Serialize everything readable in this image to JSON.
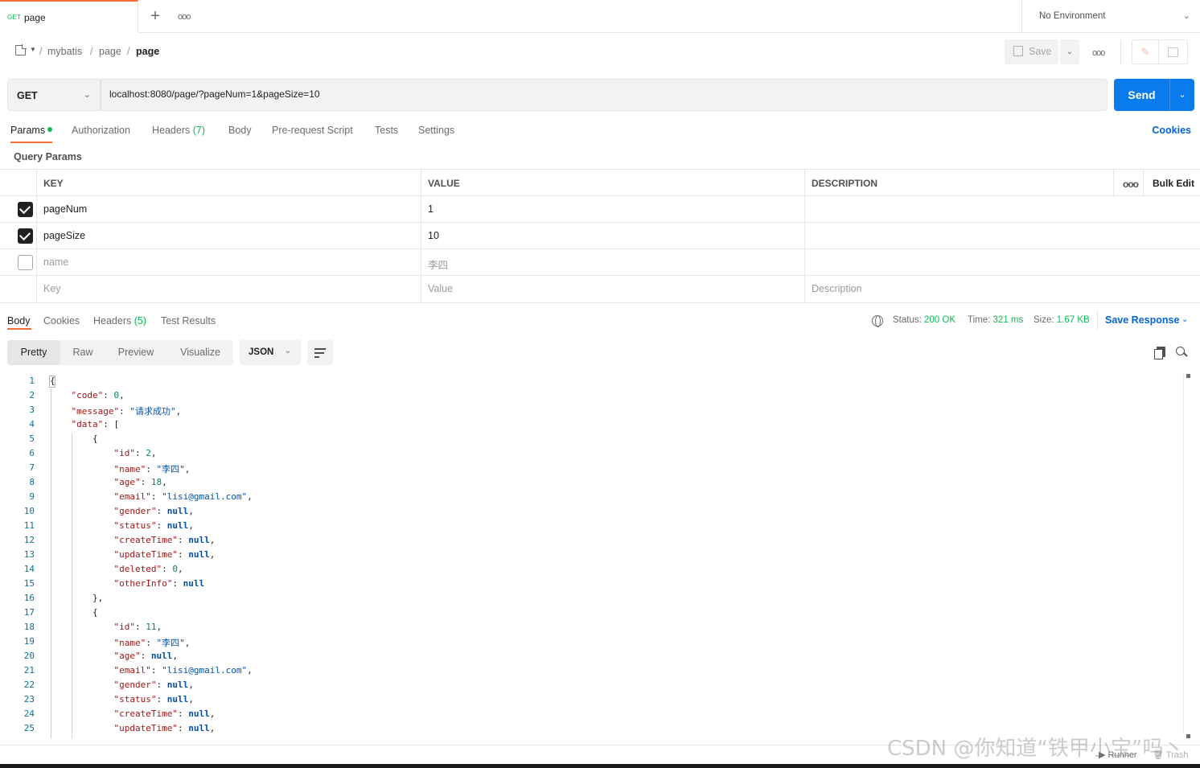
{
  "tab": {
    "method": "GET",
    "name": "page"
  },
  "environment": {
    "label": "No Environment"
  },
  "breadcrumb": [
    "mybatis",
    "page",
    "page"
  ],
  "toolbar": {
    "save_label": "Save"
  },
  "request": {
    "method": "GET",
    "url": "localhost:8080/page/?pageNum=1&pageSize=10",
    "send_label": "Send"
  },
  "request_tabs": {
    "params": "Params",
    "authorization": "Authorization",
    "headers": "Headers",
    "headers_count": "(7)",
    "body": "Body",
    "prerequest": "Pre-request Script",
    "tests": "Tests",
    "settings": "Settings",
    "cookies": "Cookies"
  },
  "query_params": {
    "title": "Query Params",
    "headers": {
      "key": "KEY",
      "value": "VALUE",
      "description": "DESCRIPTION",
      "bulk_edit": "Bulk Edit"
    },
    "rows": [
      {
        "checked": true,
        "key": "pageNum",
        "value": "1",
        "description": ""
      },
      {
        "checked": true,
        "key": "pageSize",
        "value": "10",
        "description": ""
      },
      {
        "checked": false,
        "key": "name",
        "value": "李四",
        "description": ""
      }
    ],
    "placeholder": {
      "key": "Key",
      "value": "Value",
      "description": "Description"
    }
  },
  "response": {
    "tabs": {
      "body": "Body",
      "cookies": "Cookies",
      "headers": "Headers",
      "headers_count": "(5)",
      "tests": "Test Results"
    },
    "status_label": "Status:",
    "status": "200 OK",
    "time_label": "Time:",
    "time": "321 ms",
    "size_label": "Size:",
    "size": "1.67 KB",
    "save_label": "Save Response",
    "views": [
      "Pretty",
      "Raw",
      "Preview",
      "Visualize"
    ],
    "format": "JSON"
  },
  "code_lines": [
    [
      0,
      [
        [
          "p",
          "{"
        ]
      ]
    ],
    [
      1,
      [
        [
          "k",
          "\"code\""
        ],
        [
          "p",
          ": "
        ],
        [
          "n",
          "0"
        ],
        [
          "p",
          ","
        ]
      ]
    ],
    [
      1,
      [
        [
          "k",
          "\"message\""
        ],
        [
          "p",
          ": "
        ],
        [
          "s",
          "\"请求成功\""
        ],
        [
          "p",
          ","
        ]
      ]
    ],
    [
      1,
      [
        [
          "k",
          "\"data\""
        ],
        [
          "p",
          ": ["
        ]
      ]
    ],
    [
      2,
      [
        [
          "p",
          "{"
        ]
      ]
    ],
    [
      3,
      [
        [
          "k",
          "\"id\""
        ],
        [
          "p",
          ": "
        ],
        [
          "n",
          "2"
        ],
        [
          "p",
          ","
        ]
      ]
    ],
    [
      3,
      [
        [
          "k",
          "\"name\""
        ],
        [
          "p",
          ": "
        ],
        [
          "s",
          "\"李四\""
        ],
        [
          "p",
          ","
        ]
      ]
    ],
    [
      3,
      [
        [
          "k",
          "\"age\""
        ],
        [
          "p",
          ": "
        ],
        [
          "n",
          "18"
        ],
        [
          "p",
          ","
        ]
      ]
    ],
    [
      3,
      [
        [
          "k",
          "\"email\""
        ],
        [
          "p",
          ": "
        ],
        [
          "s",
          "\"lisi@gmail.com\""
        ],
        [
          "p",
          ","
        ]
      ]
    ],
    [
      3,
      [
        [
          "k",
          "\"gender\""
        ],
        [
          "p",
          ": "
        ],
        [
          "nl",
          "null"
        ],
        [
          "p",
          ","
        ]
      ]
    ],
    [
      3,
      [
        [
          "k",
          "\"status\""
        ],
        [
          "p",
          ": "
        ],
        [
          "nl",
          "null"
        ],
        [
          "p",
          ","
        ]
      ]
    ],
    [
      3,
      [
        [
          "k",
          "\"createTime\""
        ],
        [
          "p",
          ": "
        ],
        [
          "nl",
          "null"
        ],
        [
          "p",
          ","
        ]
      ]
    ],
    [
      3,
      [
        [
          "k",
          "\"updateTime\""
        ],
        [
          "p",
          ": "
        ],
        [
          "nl",
          "null"
        ],
        [
          "p",
          ","
        ]
      ]
    ],
    [
      3,
      [
        [
          "k",
          "\"deleted\""
        ],
        [
          "p",
          ": "
        ],
        [
          "n",
          "0"
        ],
        [
          "p",
          ","
        ]
      ]
    ],
    [
      3,
      [
        [
          "k",
          "\"otherInfo\""
        ],
        [
          "p",
          ": "
        ],
        [
          "nl",
          "null"
        ]
      ]
    ],
    [
      2,
      [
        [
          "p",
          "},"
        ]
      ]
    ],
    [
      2,
      [
        [
          "p",
          "{"
        ]
      ]
    ],
    [
      3,
      [
        [
          "k",
          "\"id\""
        ],
        [
          "p",
          ": "
        ],
        [
          "n",
          "11"
        ],
        [
          "p",
          ","
        ]
      ]
    ],
    [
      3,
      [
        [
          "k",
          "\"name\""
        ],
        [
          "p",
          ": "
        ],
        [
          "s",
          "\"李四\""
        ],
        [
          "p",
          ","
        ]
      ]
    ],
    [
      3,
      [
        [
          "k",
          "\"age\""
        ],
        [
          "p",
          ": "
        ],
        [
          "nl",
          "null"
        ],
        [
          "p",
          ","
        ]
      ]
    ],
    [
      3,
      [
        [
          "k",
          "\"email\""
        ],
        [
          "p",
          ": "
        ],
        [
          "s",
          "\"lisi@gmail.com\""
        ],
        [
          "p",
          ","
        ]
      ]
    ],
    [
      3,
      [
        [
          "k",
          "\"gender\""
        ],
        [
          "p",
          ": "
        ],
        [
          "nl",
          "null"
        ],
        [
          "p",
          ","
        ]
      ]
    ],
    [
      3,
      [
        [
          "k",
          "\"status\""
        ],
        [
          "p",
          ": "
        ],
        [
          "nl",
          "null"
        ],
        [
          "p",
          ","
        ]
      ]
    ],
    [
      3,
      [
        [
          "k",
          "\"createTime\""
        ],
        [
          "p",
          ": "
        ],
        [
          "nl",
          "null"
        ],
        [
          "p",
          ","
        ]
      ]
    ],
    [
      3,
      [
        [
          "k",
          "\"updateTime\""
        ],
        [
          "p",
          ": "
        ],
        [
          "nl",
          "null"
        ],
        [
          "p",
          ","
        ]
      ]
    ]
  ],
  "statusbar": {
    "runner": "Runner",
    "trash": "Trash"
  },
  "watermark": "CSDN @你知道“铁甲小宝”吗丶",
  "colors": {
    "accent": "#ff6c37",
    "primary": "#097bed",
    "success": "#0cbb52"
  },
  "icons": [
    "plus-icon",
    "more-icon",
    "chevron-down-icon",
    "collection-icon",
    "save-icon",
    "edit-icon",
    "doc-icon",
    "globe-icon",
    "copy-icon",
    "search-icon",
    "wrap-icon"
  ]
}
